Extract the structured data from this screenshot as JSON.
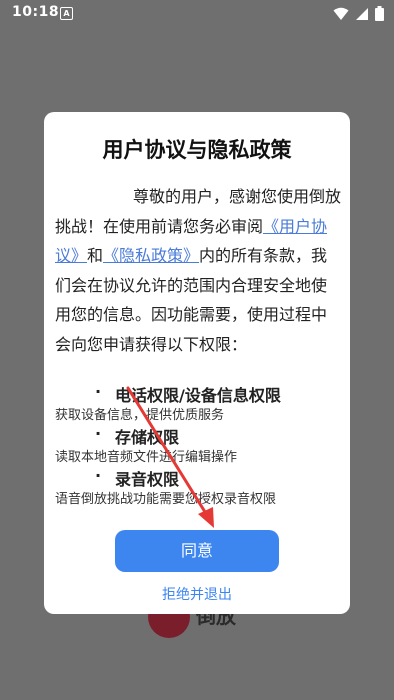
{
  "status_bar": {
    "time": "10:18",
    "left_icon": "A",
    "icons": [
      "wifi-icon",
      "signal-icon",
      "battery-icon"
    ]
  },
  "dialog": {
    "title": "用户协议与隐私政策",
    "intro_before": "尊敬的用户，感谢您使用倒放挑战！在使用前请您务必审阅",
    "link_user_agreement": "《用户协议》",
    "and_text": "和",
    "link_privacy_policy": "《隐私政策》",
    "intro_after": "内的所有条款，我们会在协议允许的范围内合理安全地使用您的信息。因功能需要，使用过程中会向您申请获得以下权限：",
    "permissions": [
      {
        "title": "电话权限/设备信息权限",
        "desc": "获取设备信息，提供优质服务"
      },
      {
        "title": "存储权限",
        "desc": "读取本地音频文件进行编辑操作"
      },
      {
        "title": "录音权限",
        "desc": "语音倒放挑战功能需要您授权录音权限"
      }
    ],
    "bullet": "·",
    "agree_label": "同意",
    "reject_label": "拒绝并退出"
  },
  "background": {
    "logo_text": "倒放"
  },
  "colors": {
    "overlay": "#6f6f6f",
    "accent": "#3d86f0",
    "link": "#4a7bd8",
    "annotation": "#e53935"
  }
}
